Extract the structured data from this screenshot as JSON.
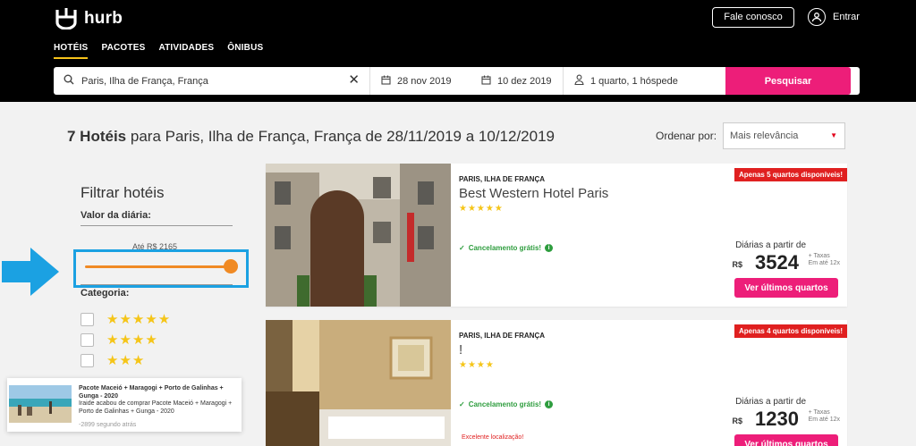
{
  "brand": {
    "name": "hurb"
  },
  "header": {
    "contact_label": "Fale conosco",
    "login_label": "Entrar"
  },
  "nav": {
    "tabs": [
      {
        "label": "HOTÉIS",
        "active": true
      },
      {
        "label": "PACOTES",
        "active": false
      },
      {
        "label": "ATIVIDADES",
        "active": false
      },
      {
        "label": "ÔNIBUS",
        "active": false
      }
    ]
  },
  "search": {
    "destination": "Paris, Ilha de França, França",
    "checkin": "28 nov 2019",
    "checkout": "10 dez 2019",
    "guests": "1 quarto, 1 hóspede",
    "button_label": "Pesquisar"
  },
  "results": {
    "count": "7 Hotéis",
    "summary": "para Paris, Ilha de França, França de 28/11/2019 a 10/12/2019",
    "sort_label": "Ordenar por:",
    "sort_value": "Mais relevância"
  },
  "filters": {
    "title": "Filtrar hotéis",
    "price_section": "Valor da diária:",
    "price_max_label": "Até R$ 2165",
    "price_fraction": 1.0,
    "category_section": "Categoria:",
    "categories": [
      "★★★★★",
      "★★★★",
      "★★★"
    ]
  },
  "toast": {
    "title": "Pacote Maceió + Maragogi + Porto de Galinhas + Gunga - 2020",
    "body": "Iraide acabou de comprar Pacote Maceió + Maragogi + Porto de Galinhas + Gunga - 2020",
    "time": "-2899 segundo atrás"
  },
  "hotels": [
    {
      "location": "PARIS, ILHA DE FRANÇA",
      "name": "Best Western Hotel Paris",
      "stars": "★★★★★",
      "cancel": "Cancelamento grátis!",
      "badge": "Apenas 5 quartos disponíveis!",
      "price_label": "Diárias a partir de",
      "currency": "R$",
      "price": "3524",
      "taxes_line1": "+ Taxas",
      "taxes_line2": "Em até 12x",
      "cta": "Ver últimos quartos",
      "note": ""
    },
    {
      "location": "PARIS, ILHA DE FRANÇA",
      "name": "!",
      "stars": "★★★★",
      "cancel": "Cancelamento grátis!",
      "badge": "Apenas 4 quartos disponíveis!",
      "price_label": "Diárias a partir de",
      "currency": "R$",
      "price": "1230",
      "taxes_line1": "+ Taxas",
      "taxes_line2": "Em até 12x",
      "cta": "Ver últimos quartos",
      "note": "Excelente localização!"
    }
  ]
}
